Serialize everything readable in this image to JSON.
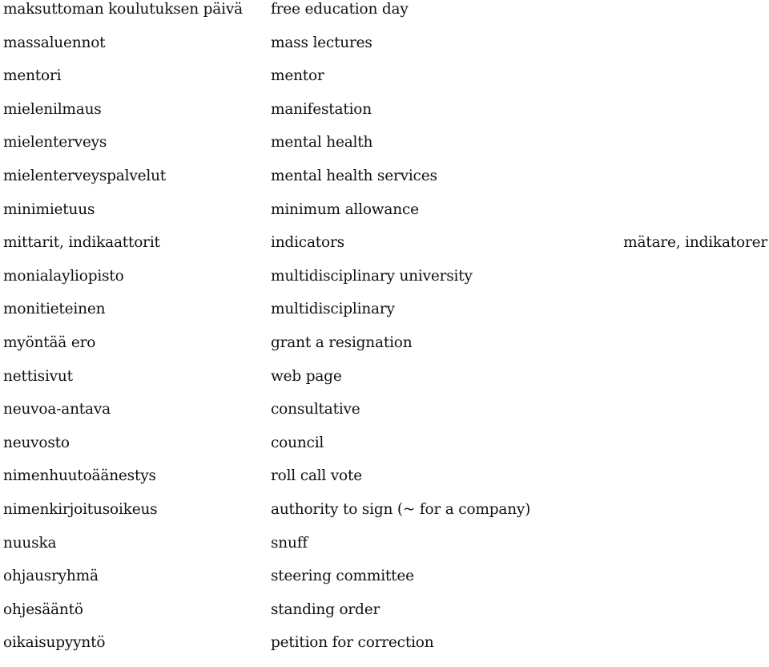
{
  "glossary": {
    "entries": [
      {
        "fi": "maksuttoman koulutuksen päivä",
        "en": "free education day",
        "sv": ""
      },
      {
        "fi": "massaluennot",
        "en": "mass lectures",
        "sv": ""
      },
      {
        "fi": "mentori",
        "en": "mentor",
        "sv": ""
      },
      {
        "fi": "mielenilmaus",
        "en": "manifestation",
        "sv": ""
      },
      {
        "fi": "mielenterveys",
        "en": "mental health",
        "sv": ""
      },
      {
        "fi": "mielenterveyspalvelut",
        "en": "mental health services",
        "sv": ""
      },
      {
        "fi": "minimietuus",
        "en": "minimum allowance",
        "sv": ""
      },
      {
        "fi": "mittarit, indikaattorit",
        "en": "indicators",
        "sv": "mätare, indikatorer"
      },
      {
        "fi": "monialayliopisto",
        "en": "multidisciplinary university",
        "sv": ""
      },
      {
        "fi": "monitieteinen",
        "en": "multidisciplinary",
        "sv": ""
      },
      {
        "fi": "myöntää ero",
        "en": "grant a resignation",
        "sv": ""
      },
      {
        "fi": "nettisivut",
        "en": "web page",
        "sv": ""
      },
      {
        "fi": "neuvoa-antava",
        "en": "consultative",
        "sv": ""
      },
      {
        "fi": "neuvosto",
        "en": "council",
        "sv": ""
      },
      {
        "fi": "nimenhuutoäänestys",
        "en": "roll call vote",
        "sv": ""
      },
      {
        "fi": "nimenkirjoitusoikeus",
        "en": "authority to sign (~ for a company)",
        "sv": ""
      },
      {
        "fi": "nuuska",
        "en": "snuff",
        "sv": ""
      },
      {
        "fi": "ohjausryhmä",
        "en": "steering committee",
        "sv": ""
      },
      {
        "fi": "ohjesääntö",
        "en": "standing order",
        "sv": ""
      },
      {
        "fi": "oikaisupyyntö",
        "en": "petition for correction",
        "sv": ""
      }
    ]
  }
}
